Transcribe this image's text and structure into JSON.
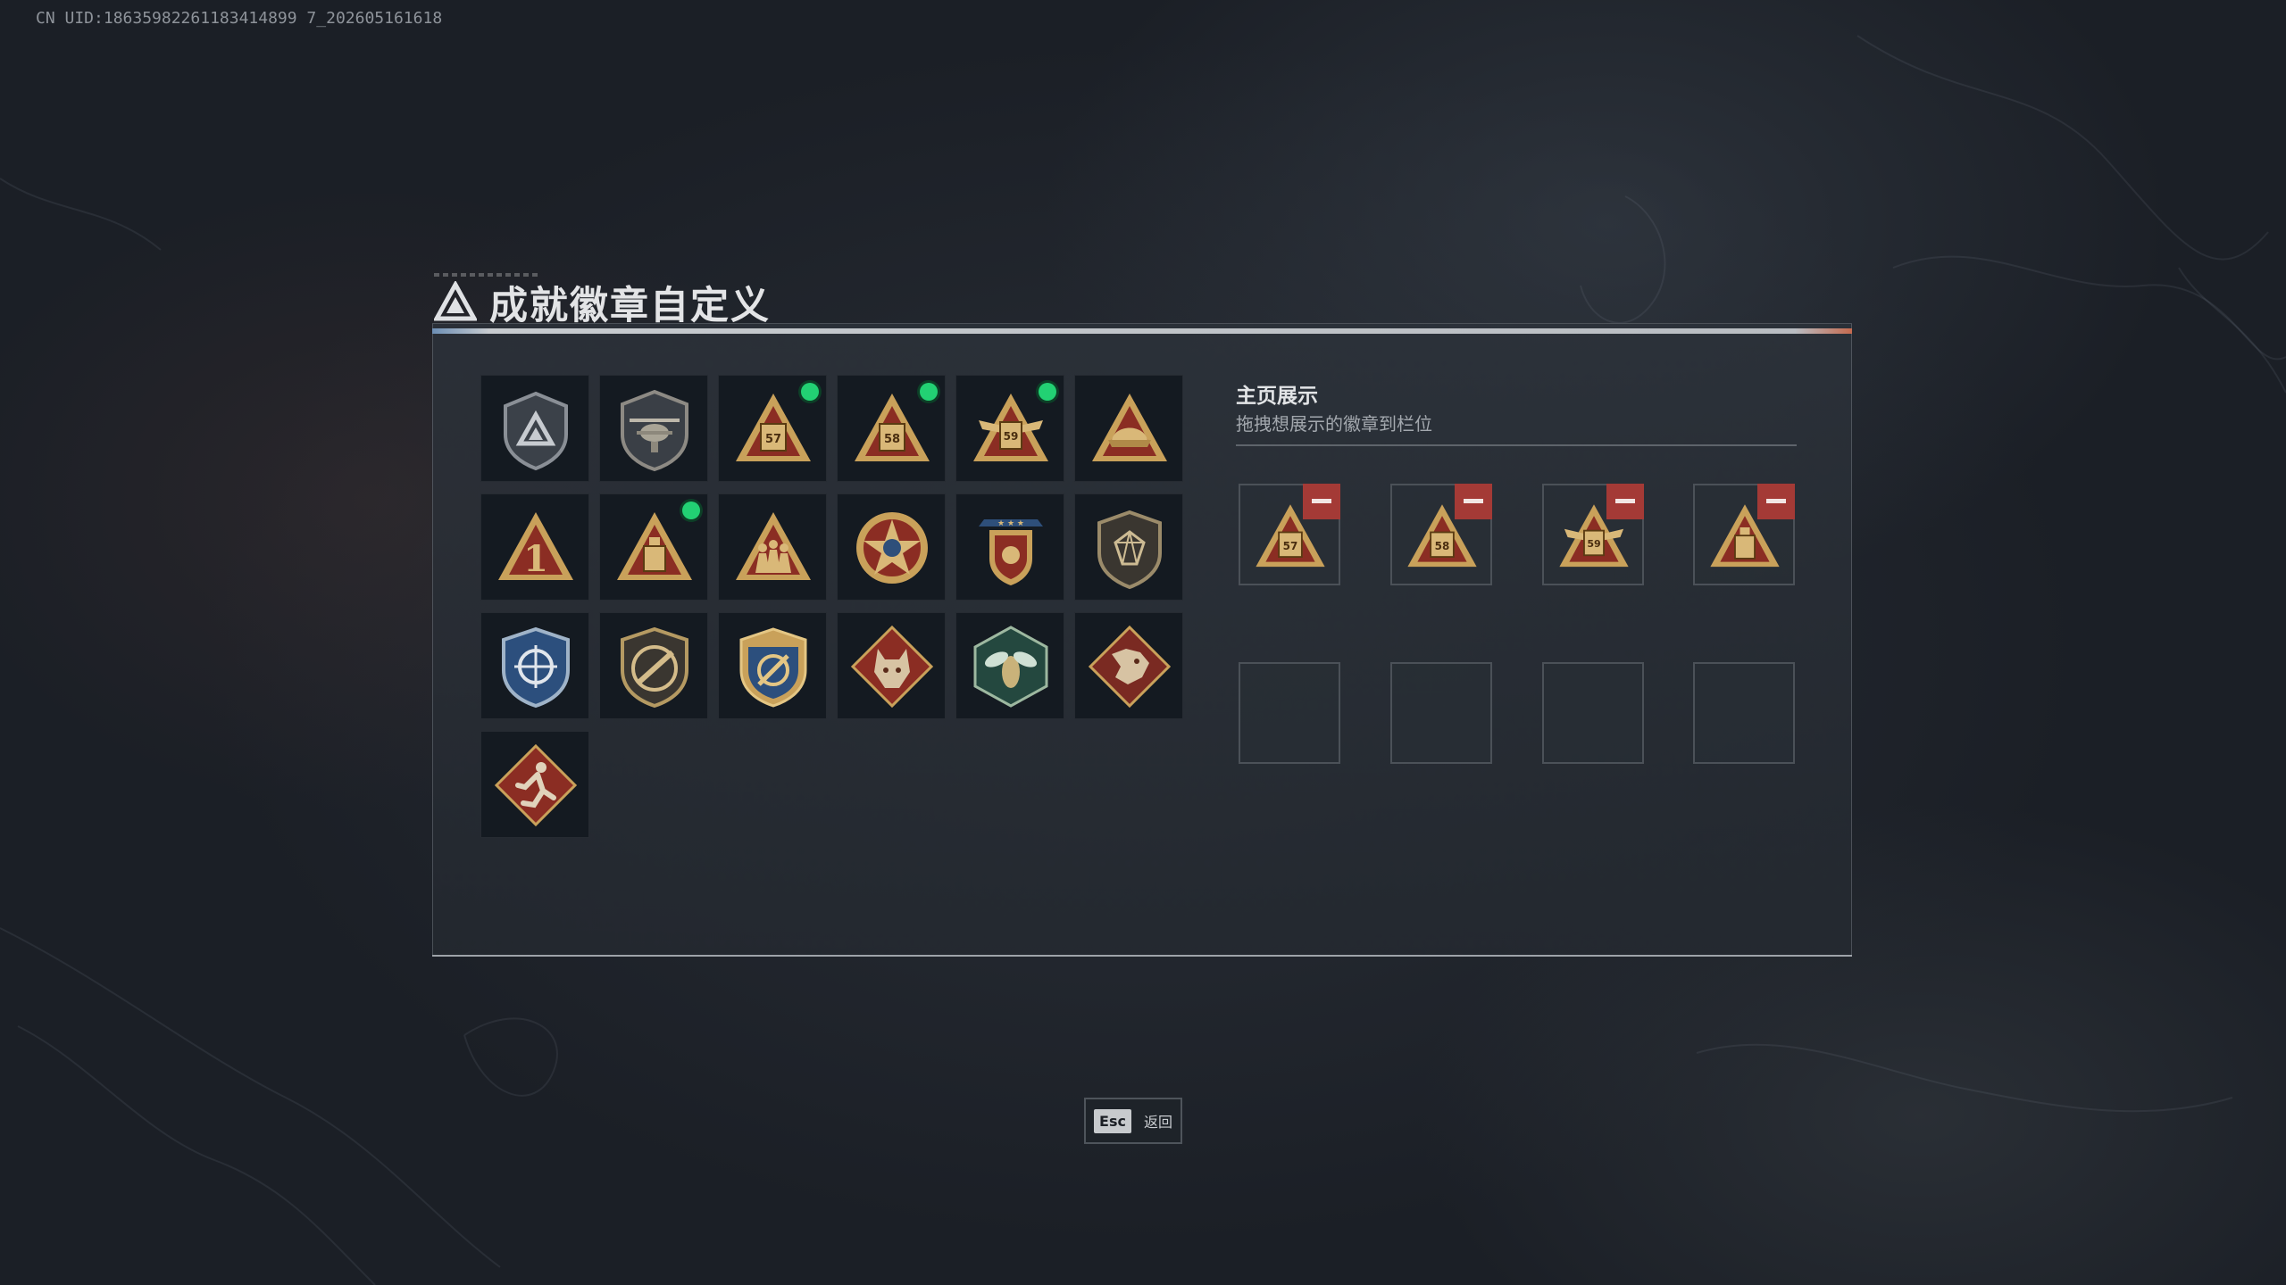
{
  "uid_text": "CN UID:18635982261183414899 7_202605161618",
  "title": "成就徽章自定义",
  "colors": {
    "accent_gold": "#c9a15a",
    "badge_red": "#8b2d23",
    "new_dot": "#22d173",
    "remove_red": "#a43a36"
  },
  "badges": [
    {
      "icon": "shield-triangle-badge-icon",
      "new": false
    },
    {
      "icon": "helicopter-shield-badge-icon",
      "new": false
    },
    {
      "icon": "triangle-57-badge-icon",
      "new": true
    },
    {
      "icon": "triangle-58-badge-icon",
      "new": true
    },
    {
      "icon": "triangle-winged-59-badge-icon",
      "new": true
    },
    {
      "icon": "triangle-helmet-badge-icon",
      "new": false
    },
    {
      "icon": "triangle-number-1-badge-icon",
      "new": false
    },
    {
      "icon": "triangle-bottle-badge-icon",
      "new": true
    },
    {
      "icon": "triangle-soldiers-badge-icon",
      "new": false
    },
    {
      "icon": "star-crest-badge-icon",
      "new": false
    },
    {
      "icon": "stars-banner-shield-badge-icon",
      "new": false
    },
    {
      "icon": "gem-shield-badge-icon",
      "new": false
    },
    {
      "icon": "blue-crosshair-shield-badge-icon",
      "new": false
    },
    {
      "icon": "rifle-shield-badge-icon",
      "new": false
    },
    {
      "icon": "gold-compass-shield-badge-icon",
      "new": false
    },
    {
      "icon": "wolf-diamond-badge-icon",
      "new": false
    },
    {
      "icon": "wasp-hexagon-badge-icon",
      "new": false
    },
    {
      "icon": "dragon-diamond-badge-icon",
      "new": false
    },
    {
      "icon": "runner-diamond-badge-icon",
      "new": false
    }
  ],
  "showcase": {
    "title": "主页展示",
    "subtitle": "拖拽想展示的徽章到栏位",
    "slots": [
      {
        "icon": "triangle-57-badge-icon",
        "filled": true
      },
      {
        "icon": "triangle-58-badge-icon",
        "filled": true
      },
      {
        "icon": "triangle-winged-59-badge-icon",
        "filled": true
      },
      {
        "icon": "triangle-bottle-badge-icon",
        "filled": true
      },
      {
        "icon": "",
        "filled": false
      },
      {
        "icon": "",
        "filled": false
      },
      {
        "icon": "",
        "filled": false
      },
      {
        "icon": "",
        "filled": false
      }
    ]
  },
  "footer": {
    "esc_key": "Esc",
    "esc_label": "返回"
  }
}
